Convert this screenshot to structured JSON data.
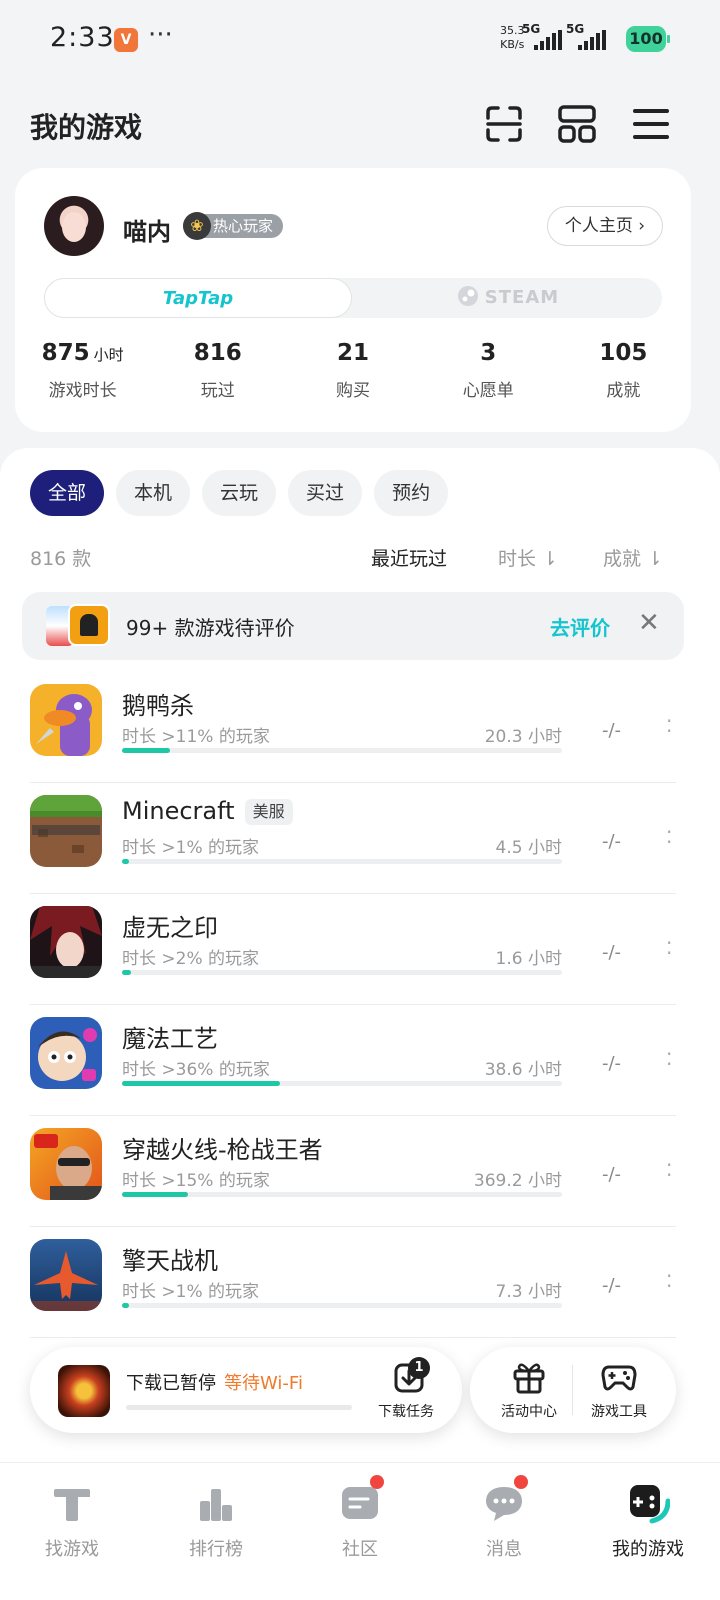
{
  "status_bar": {
    "time": "2:33",
    "more": "···",
    "speed_value": "35.3",
    "speed_unit": "KB/s",
    "net1": "5G",
    "net2": "5G",
    "battery": "100"
  },
  "header": {
    "title": "我的游戏",
    "icons": [
      "scan-icon",
      "grid-icon",
      "menu-icon"
    ]
  },
  "profile": {
    "username": "喵内",
    "badge": "热心玩家",
    "home_button": "个人主页 ›",
    "platforms": {
      "active": "TapTap",
      "inactive": "STEAM"
    },
    "stats": [
      {
        "value": "875",
        "unit": "小时",
        "label": "游戏时长"
      },
      {
        "value": "816",
        "unit": "",
        "label": "玩过"
      },
      {
        "value": "21",
        "unit": "",
        "label": "购买"
      },
      {
        "value": "3",
        "unit": "",
        "label": "心愿单"
      },
      {
        "value": "105",
        "unit": "",
        "label": "成就"
      }
    ]
  },
  "filters": {
    "chips": [
      "全部",
      "本机",
      "云玩",
      "买过",
      "预约"
    ],
    "active_chip": "全部"
  },
  "list_header": {
    "count": "816 款",
    "sort_recent": "最近玩过",
    "sort_time": "时长 ⇂",
    "sort_achievement": "成就 ⇂"
  },
  "rate_banner": {
    "text": "99+ 款游戏待评价",
    "link": "去评价",
    "close": "✕"
  },
  "games": [
    {
      "name": "鹅鸭杀",
      "tag": "",
      "pct_text": "时长 >11% 的玩家",
      "hours": "20.3 小时",
      "progress": 0.11,
      "score": "-/-",
      "icon": "goose-duck-icon"
    },
    {
      "name": "Minecraft",
      "tag": "美服",
      "pct_text": "时长 >1% 的玩家",
      "hours": "4.5 小时",
      "progress": 0.01,
      "score": "-/-",
      "icon": "minecraft-icon"
    },
    {
      "name": "虚无之印",
      "tag": "",
      "pct_text": "时长 >2% 的玩家",
      "hours": "1.6 小时",
      "progress": 0.02,
      "score": "-/-",
      "icon": "anime-hero-icon"
    },
    {
      "name": "魔法工艺",
      "tag": "",
      "pct_text": "时长 >36% 的玩家",
      "hours": "38.6 小时",
      "progress": 0.36,
      "score": "-/-",
      "icon": "magic-craft-icon"
    },
    {
      "name": "穿越火线-枪战王者",
      "tag": "",
      "pct_text": "时长 >15% 的玩家",
      "hours": "369.2 小时",
      "progress": 0.15,
      "score": "-/-",
      "icon": "crossfire-icon"
    },
    {
      "name": "擎天战机",
      "tag": "",
      "pct_text": "时长 >1% 的玩家",
      "hours": "7.3 小时",
      "progress": 0.01,
      "score": "-/-",
      "icon": "fighter-jet-icon"
    }
  ],
  "download_bar": {
    "status": "下载已暂停",
    "waiting": "等待Wi-Fi",
    "task_label": "下载任务",
    "task_count": "1",
    "progress": 0.0
  },
  "tools": {
    "activity": "活动中心",
    "game_tools": "游戏工具"
  },
  "bottom_nav": [
    {
      "label": "找游戏",
      "icon": "find-game-icon",
      "dot": false
    },
    {
      "label": "排行榜",
      "icon": "ranking-icon",
      "dot": false
    },
    {
      "label": "社区",
      "icon": "community-icon",
      "dot": true
    },
    {
      "label": "消息",
      "icon": "message-icon",
      "dot": true
    },
    {
      "label": "我的游戏",
      "icon": "my-games-icon",
      "dot": false
    }
  ],
  "colors": {
    "accent": "#15c5ce",
    "progress": "#1ec8a7",
    "chip_active": "#1d1f7a",
    "warning": "#f07b2c",
    "notification": "#f0463f"
  }
}
